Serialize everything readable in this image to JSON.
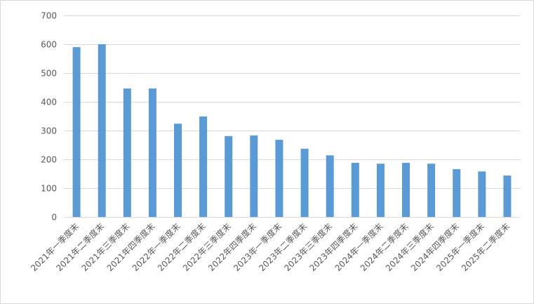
{
  "chart_data": {
    "type": "bar",
    "title": "",
    "xlabel": "",
    "ylabel": "",
    "ylim": [
      0,
      700
    ],
    "yticks": [
      0,
      100,
      200,
      300,
      400,
      500,
      600,
      700
    ],
    "grid": true,
    "legend": "none",
    "bar_color": "#5b9bd5",
    "categories": [
      "2021年一季度末",
      "2021年二季度末",
      "2021年三季度末",
      "2021年四季度末",
      "2022年一季度末",
      "2022年二季度末",
      "2022年三季度末",
      "2022年四季度末",
      "2023年一季度末",
      "2023年二季度末",
      "2023年三季度末",
      "2023年四季度末",
      "2024年一季度末",
      "2024年二季度末",
      "2024年三季度末",
      "2024年四季度末",
      "2025年一季度末",
      "2025年二季度末"
    ],
    "values": [
      590,
      600,
      446,
      446,
      324,
      349,
      281,
      283,
      268,
      237,
      214,
      188,
      185,
      188,
      185,
      166,
      158,
      144
    ]
  }
}
